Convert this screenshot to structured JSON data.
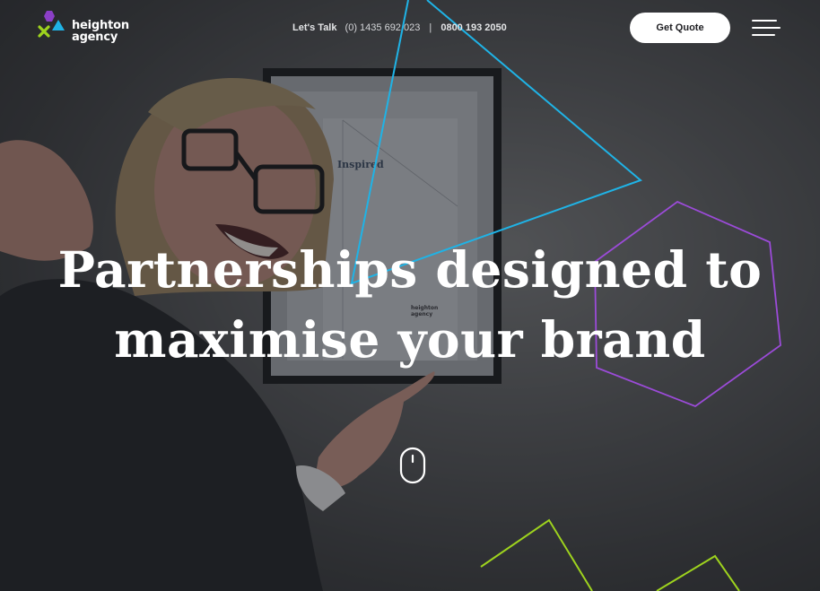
{
  "brand": {
    "logo_line1": "heighton",
    "logo_line2": "agency"
  },
  "header": {
    "contact_label": "Let's Talk",
    "phone_1": "(0) 1435 692 023",
    "separator": "|",
    "phone_2": "0800 193 2050",
    "quote_button": "Get Quote"
  },
  "background": {
    "frame_word": "Inspired",
    "frame_logo_1": "heighton",
    "frame_logo_2": "agency"
  },
  "hero": {
    "headline_line1": "Partnerships designed to",
    "headline_line2": "maximise your brand"
  },
  "colors": {
    "blue": "#1fb3e6",
    "purple": "#9b4bd8",
    "green": "#9ed31e",
    "white": "#ffffff"
  },
  "icons": [
    "logo-mark-icon",
    "hamburger-menu-icon",
    "mouse-scroll-icon"
  ]
}
